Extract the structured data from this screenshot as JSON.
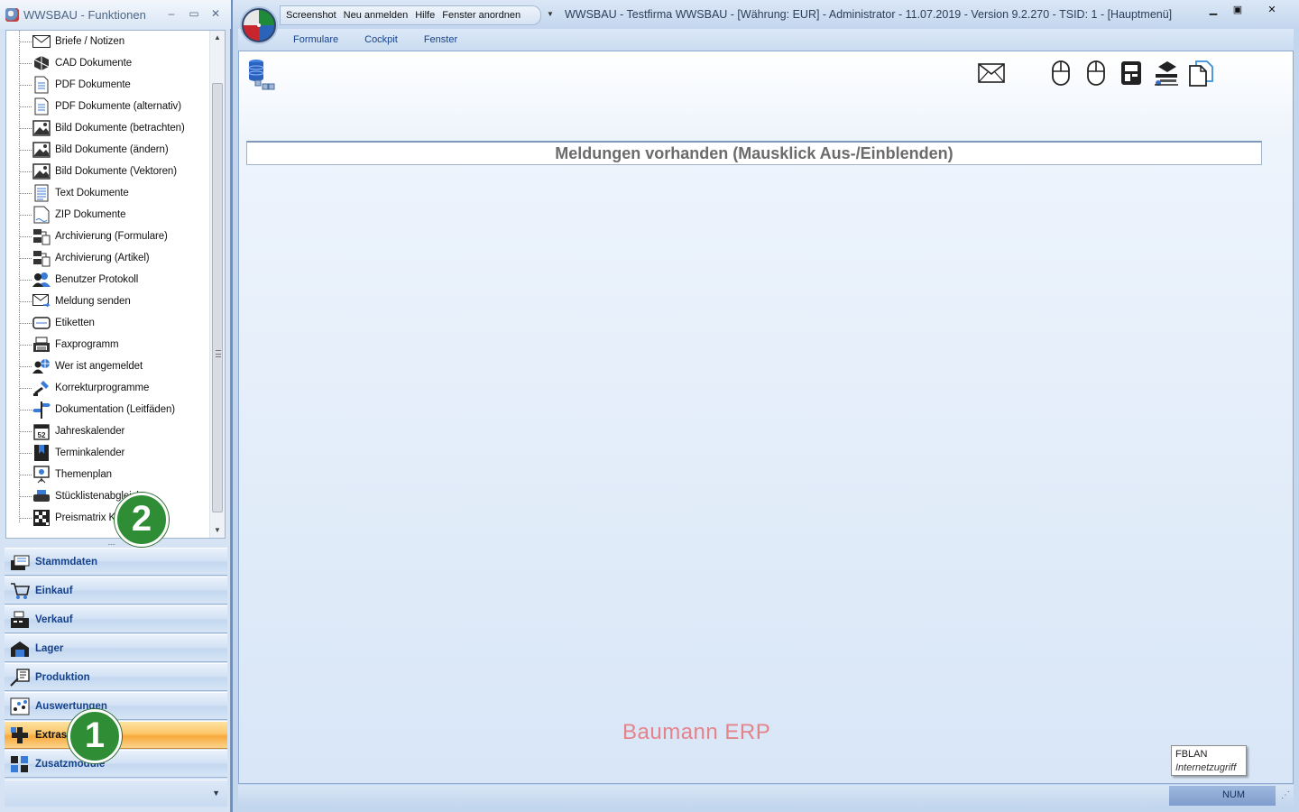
{
  "left_window": {
    "title": "WWSBAU - Funktionen",
    "minimize": "–",
    "restore": "▭",
    "close": "✕",
    "tree_items": [
      {
        "label": "Briefe / Notizen",
        "icon": "envelope-icon"
      },
      {
        "label": "CAD Dokumente",
        "icon": "cad-icon"
      },
      {
        "label": "PDF Dokumente",
        "icon": "document-icon"
      },
      {
        "label": "PDF Dokumente (alternativ)",
        "icon": "document-icon"
      },
      {
        "label": "Bild Dokumente (betrachten)",
        "icon": "image-icon"
      },
      {
        "label": "Bild Dokumente (ändern)",
        "icon": "image-icon"
      },
      {
        "label": "Bild Dokumente (Vektoren)",
        "icon": "image-icon"
      },
      {
        "label": "Text Dokumente",
        "icon": "text-document-icon"
      },
      {
        "label": "ZIP Dokumente",
        "icon": "zip-icon"
      },
      {
        "label": "Archivierung (Formulare)",
        "icon": "archive-icon"
      },
      {
        "label": "Archivierung (Artikel)",
        "icon": "archive-icon"
      },
      {
        "label": "Benutzer Protokoll",
        "icon": "users-icon"
      },
      {
        "label": "Meldung senden",
        "icon": "send-mail-icon"
      },
      {
        "label": "Etiketten",
        "icon": "label-icon"
      },
      {
        "label": "Faxprogramm",
        "icon": "fax-icon"
      },
      {
        "label": "Wer ist angemeldet",
        "icon": "user-globe-icon"
      },
      {
        "label": "Korrekturprogramme",
        "icon": "tools-icon"
      },
      {
        "label": "Dokumentation (Leitfäden)",
        "icon": "signpost-icon"
      },
      {
        "label": "Jahreskalender",
        "icon": "calendar-icon"
      },
      {
        "label": "Terminkalender",
        "icon": "bookmark-calendar-icon"
      },
      {
        "label": "Themenplan",
        "icon": "presentation-icon"
      },
      {
        "label": "Stücklistenabgleich",
        "icon": "printer-icon"
      },
      {
        "label": "Preismatrix KF",
        "icon": "matrix-icon"
      }
    ],
    "nav_buttons": [
      {
        "label": "Stammdaten",
        "icon": "masterdata-icon",
        "active": false
      },
      {
        "label": "Einkauf",
        "icon": "cart-icon",
        "active": false
      },
      {
        "label": "Verkauf",
        "icon": "cash-register-icon",
        "active": false
      },
      {
        "label": "Lager",
        "icon": "warehouse-icon",
        "active": false
      },
      {
        "label": "Produktion",
        "icon": "production-icon",
        "active": false
      },
      {
        "label": "Auswertungen",
        "icon": "analytics-icon",
        "active": false
      },
      {
        "label": "Extras",
        "icon": "extras-icon",
        "active": true
      },
      {
        "label": "Zusatzmodule",
        "icon": "modules-icon",
        "active": false
      }
    ]
  },
  "main_window": {
    "quick_access": [
      "Screenshot",
      "Neu anmelden",
      "Hilfe",
      "Fenster anordnen"
    ],
    "caption": "WWSBAU - Testfirma WWSBAU - [Währung: EUR] - Administrator - 11.07.2019 - Version 9.2.270 - TSID: 1  - [Hauptmenü]",
    "ribbon_tabs": [
      "Formulare",
      "Cockpit",
      "Fenster"
    ],
    "message_bar": "Meldungen vorhanden  (Mausklick Aus-/Einblenden)",
    "brand": "Baumann ERP",
    "connection": {
      "name": "FBLAN",
      "type": "Internetzugriff"
    },
    "status_num": "NUM",
    "toolbar_icons": [
      "mail-icon",
      "mouse-icon",
      "mouse-icon",
      "server-icon",
      "network-icon",
      "copy-document-icon"
    ]
  },
  "callouts": [
    "1",
    "2"
  ],
  "colors": {
    "active_nav": "#f8a93b",
    "brand": "#e5838a",
    "callout": "#2f8d35",
    "nav_text": "#15428b"
  }
}
